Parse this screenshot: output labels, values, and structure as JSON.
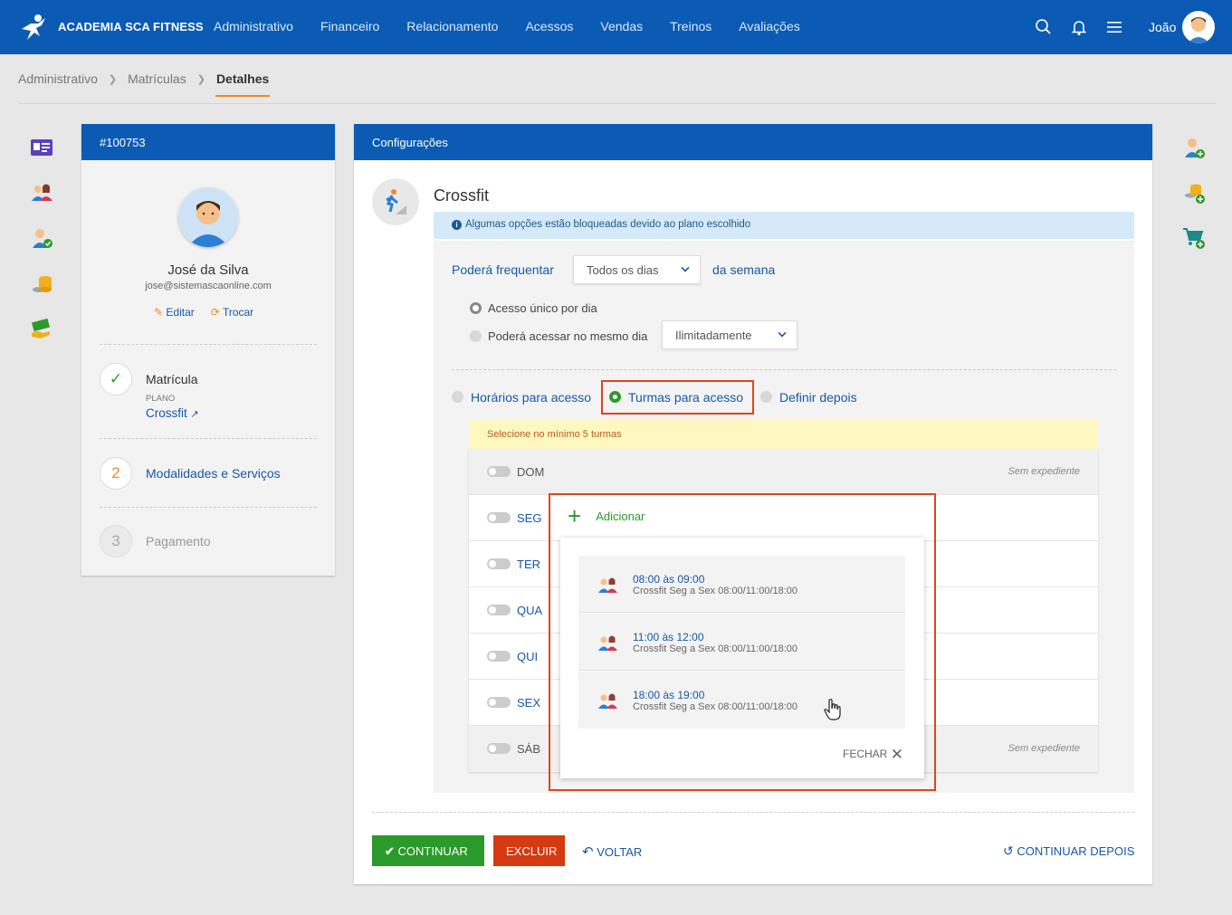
{
  "app": {
    "brand": "ACADEMIA SCA FITNESS",
    "user": "João"
  },
  "nav": [
    "Administrativo",
    "Financeiro",
    "Relacionamento",
    "Acessos",
    "Vendas",
    "Treinos",
    "Avaliações"
  ],
  "breadcrumb": [
    "Administrativo",
    "Matrículas",
    "Detalhes"
  ],
  "left_card": {
    "id": "#100753",
    "name": "José da Silva",
    "email": "jose@sistemascaonline.com",
    "edit_label": "Editar",
    "swap_label": "Trocar",
    "steps": [
      {
        "number": "",
        "title": "Matrícula",
        "sub_label": "PLANO",
        "sub_value": "Crossfit"
      },
      {
        "number": "2",
        "title": "Modalidades e Serviços"
      },
      {
        "number": "3",
        "title": "Pagamento"
      }
    ]
  },
  "main": {
    "header": "Configurações",
    "modality": "Crossfit",
    "info": "Algumas opções estão bloqueadas devido ao plano escolhido",
    "frequency_label": "Poderá frequentar",
    "frequency_value": "Todos os dias",
    "frequency_suffix": "da semana",
    "access_single": "Acesso único por dia",
    "access_multi": "Poderá acessar no mesmo dia",
    "access_multi_value": "Ilimitadamente",
    "mode_options": [
      "Horários para acesso",
      "Turmas para acesso",
      "Definir depois"
    ],
    "warning": "Selecione no mínimo 5 turmas",
    "days": [
      {
        "label": "DOM",
        "status": "Sem expediente"
      },
      {
        "label": "SEG",
        "status": ""
      },
      {
        "label": "TER",
        "status": ""
      },
      {
        "label": "QUA",
        "status": ""
      },
      {
        "label": "QUI",
        "status": ""
      },
      {
        "label": "SEX",
        "status": ""
      },
      {
        "label": "SÁB",
        "status": "Sem expediente"
      }
    ],
    "add_label": "Adicionar",
    "classes": [
      {
        "time": "08:00 às 09:00",
        "desc": "Crossfit Seg a Sex 08:00/11:00/18:00"
      },
      {
        "time": "11:00 às 12:00",
        "desc": "Crossfit Seg a Sex 08:00/11:00/18:00"
      },
      {
        "time": "18:00 às 19:00",
        "desc": "Crossfit Seg a Sex 08:00/11:00/18:00"
      }
    ],
    "close_label": "FECHAR",
    "buttons": {
      "continue": "CONTINUAR",
      "delete": "EXCLUIR",
      "back": "VOLTAR",
      "later": "CONTINUAR DEPOIS"
    }
  },
  "colors": {
    "primary": "#0b5bb5",
    "success": "#2a9a2a",
    "danger": "#d53a12",
    "highlight": "#d9471f",
    "accent": "#f08a22"
  }
}
